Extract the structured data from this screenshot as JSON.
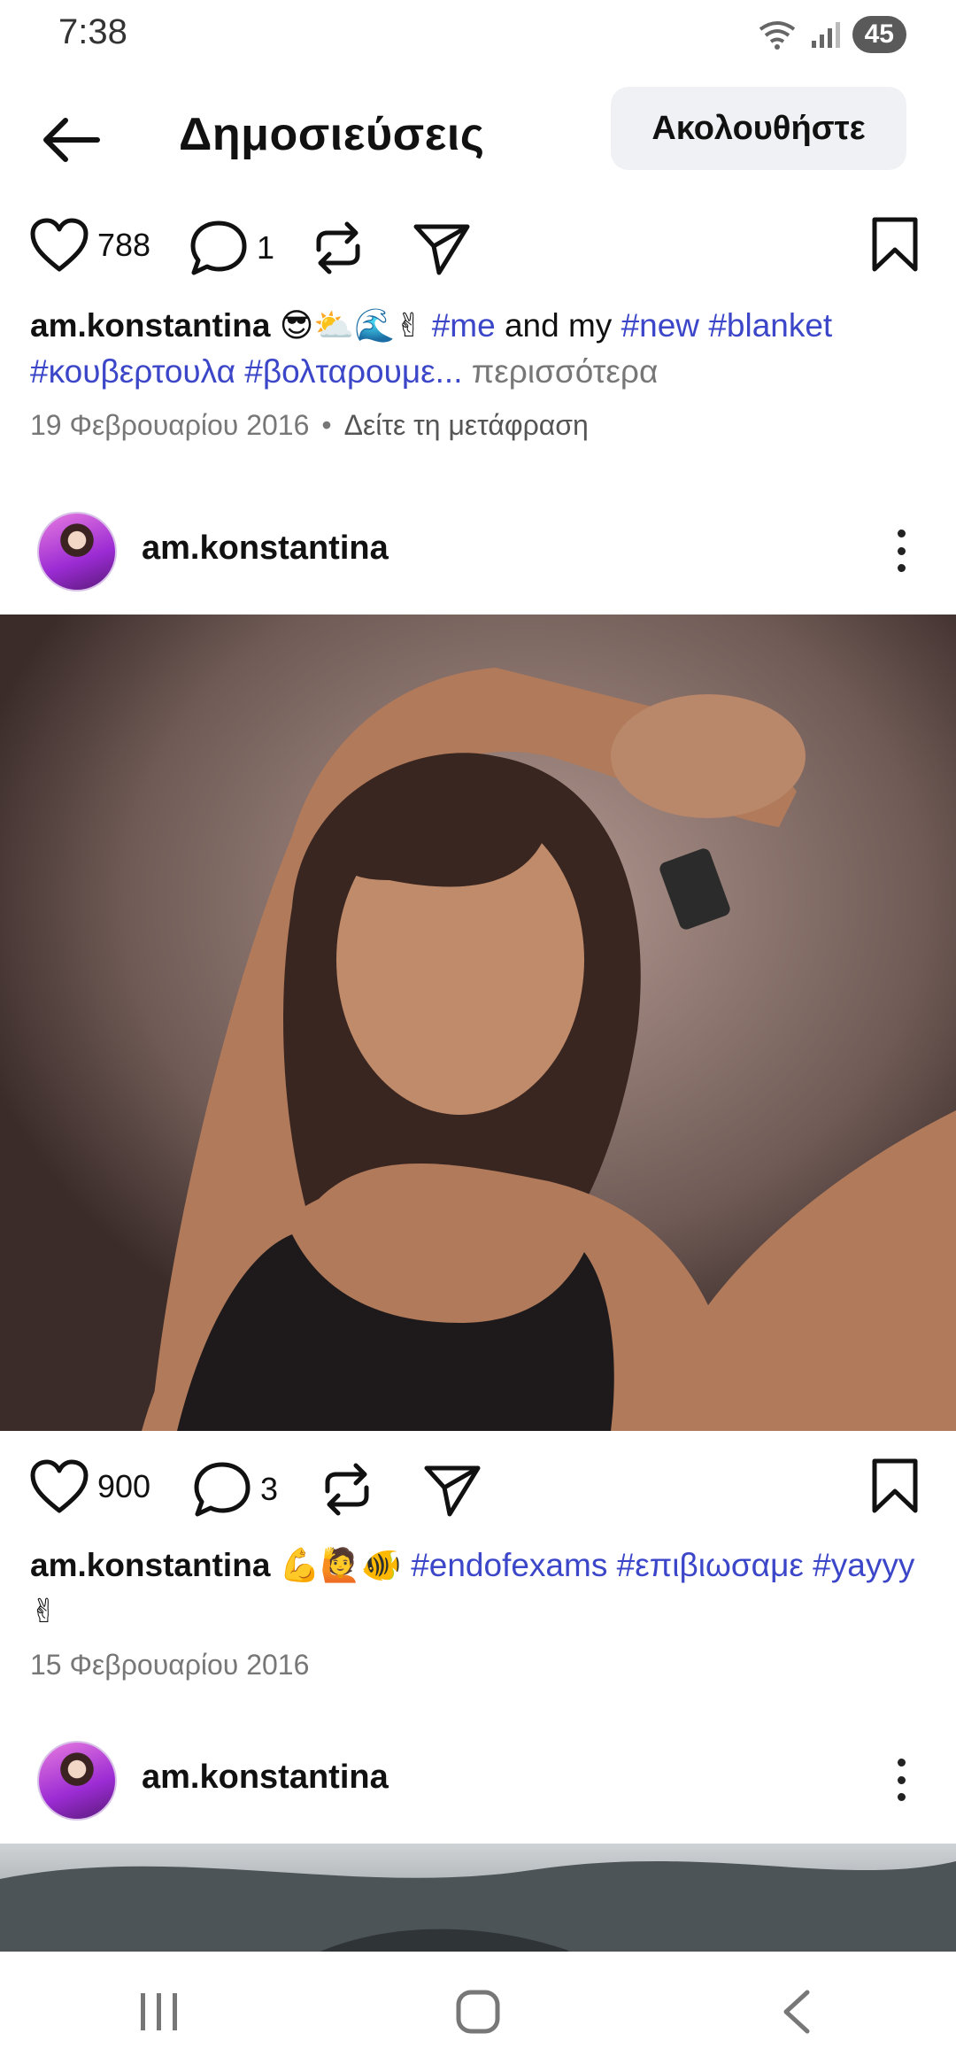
{
  "status_bar": {
    "time": "7:38",
    "battery": "45"
  },
  "header": {
    "title": "Δημοσιεύσεις",
    "follow_label": "Ακολουθήστε"
  },
  "posts": [
    {
      "likes": "788",
      "comments": "1",
      "caption": {
        "user": "am.konstantina",
        "emoji": "😎⛅🌊✌",
        "tag1": "#me",
        "text1": "and my",
        "tag2": "#new",
        "tag3": "#blanket",
        "tag4": "#κουβερτουλα",
        "tag5": "#βολταρουμε...",
        "more": "περισσότερα"
      },
      "date": "19 Φεβρουαρίου 2016",
      "translate": "Δείτε τη μετάφραση"
    },
    {
      "username": "am.konstantina",
      "likes": "900",
      "comments": "3",
      "caption": {
        "user": "am.konstantina",
        "emoji": "💪🙋🐠",
        "tag1": "#endofexams",
        "tag2": "#επιβιωσαμε",
        "tag3": "#yayyy",
        "emoji2": "✌"
      },
      "date": "15 Φεβρουαρίου 2016"
    },
    {
      "username": "am.konstantina"
    }
  ],
  "icons": {
    "back": "arrow-left-icon",
    "like": "heart-icon",
    "comment": "comment-icon",
    "repost": "repost-icon",
    "share": "send-icon",
    "save": "bookmark-icon",
    "more": "more-vertical-icon"
  },
  "colors": {
    "hashtag": "#3b46c8",
    "follow_bg": "#f0f1f4"
  }
}
